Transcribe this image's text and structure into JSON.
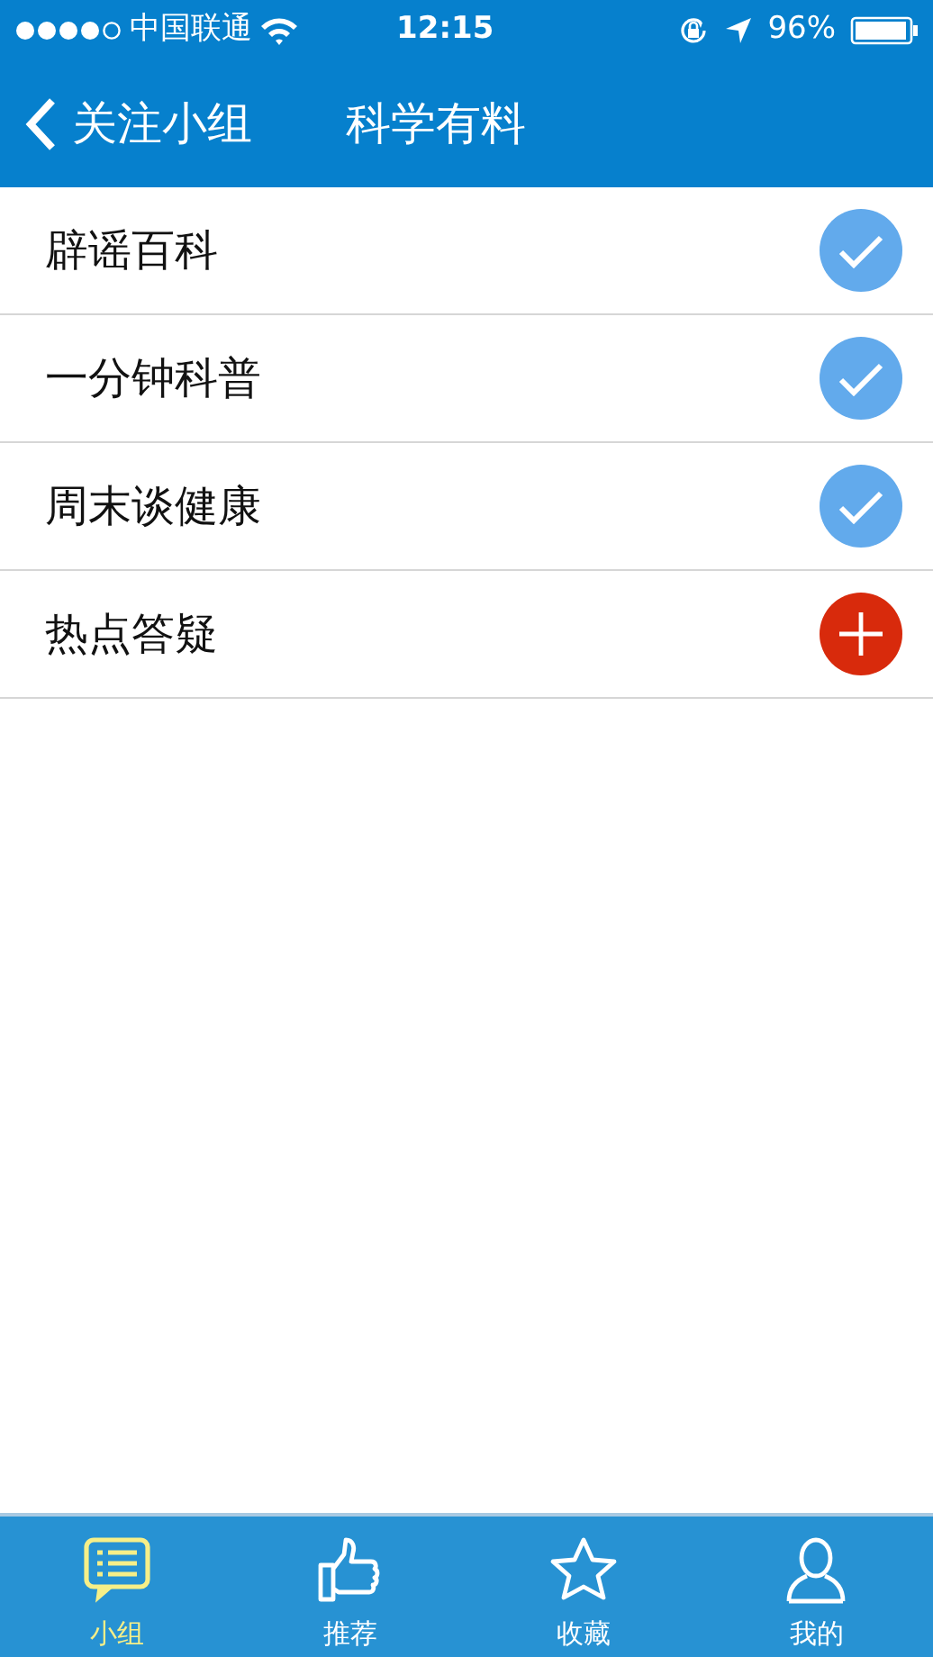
{
  "status_bar": {
    "carrier": "中国联通",
    "time": "12:15",
    "battery": "96%"
  },
  "nav_bar": {
    "back": "关注小组",
    "title": "科学有料"
  },
  "groups": [
    {
      "name": "辟谣百科",
      "followed": true
    },
    {
      "name": "一分钟科普",
      "followed": true
    },
    {
      "name": "周末谈健康",
      "followed": true
    },
    {
      "name": "热点答疑",
      "followed": false
    }
  ],
  "tabs": [
    {
      "kind": "groups",
      "label": "小组",
      "selected": true
    },
    {
      "kind": "recommend",
      "label": "推荐",
      "selected": false
    },
    {
      "kind": "favorites",
      "label": "收藏",
      "selected": false
    },
    {
      "kind": "me",
      "label": "我的",
      "selected": false
    }
  ]
}
